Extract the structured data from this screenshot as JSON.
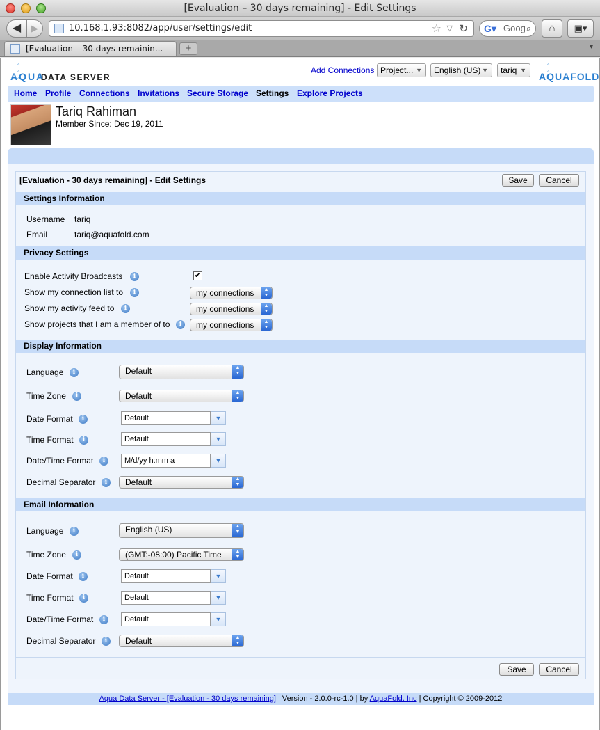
{
  "browser": {
    "window_title": "[Evaluation – 30 days remaining] - Edit Settings",
    "url": "10.168.1.93:8082/app/user/settings/edit",
    "search_placeholder": "Goog",
    "tab_title": "[Evaluation – 30 days remainin...",
    "new_tab_label": "+"
  },
  "header": {
    "logo_left_top": "° ° °",
    "logo_left_word": "AQUA",
    "logo_left_sub": "DATA SERVER",
    "add_connections": "Add Connections",
    "project_select": "Project...",
    "language_select": "English (US)",
    "user_select": "tariq",
    "logo_right_top": "° ° °",
    "logo_right_word": "AQUAFOLD"
  },
  "nav": {
    "home": "Home",
    "profile": "Profile",
    "connections": "Connections",
    "invitations": "Invitations",
    "secure_storage": "Secure Storage",
    "settings": "Settings",
    "explore_projects": "Explore Projects"
  },
  "profile": {
    "name": "Tariq Rahiman",
    "member_since": "Member Since: Dec 19, 2011"
  },
  "form": {
    "title": "[Evaluation - 30 days remaining] - Edit Settings",
    "save": "Save",
    "cancel": "Cancel"
  },
  "settings_info": {
    "header": "Settings Information",
    "username_label": "Username",
    "username_value": "tariq",
    "email_label": "Email",
    "email_value": "tariq@aquafold.com"
  },
  "privacy": {
    "header": "Privacy Settings",
    "broadcasts_label": "Enable Activity Broadcasts",
    "broadcasts_checked": "✔",
    "connection_list_label": "Show my connection list to",
    "connection_list_value": "my connections",
    "activity_feed_label": "Show my activity feed to",
    "activity_feed_value": "my connections",
    "projects_label": "Show projects that I am a member of to",
    "projects_value": "my connections"
  },
  "display": {
    "header": "Display Information",
    "language_label": "Language",
    "language_value": "Default",
    "timezone_label": "Time Zone",
    "timezone_value": "Default",
    "date_format_label": "Date Format",
    "date_format_value": "Default",
    "time_format_label": "Time Format",
    "time_format_value": "Default",
    "datetime_format_label": "Date/Time Format",
    "datetime_format_value": "M/d/yy h:mm a",
    "decimal_label": "Decimal Separator",
    "decimal_value": "Default"
  },
  "email": {
    "header": "Email Information",
    "language_label": "Language",
    "language_value": "English (US)",
    "timezone_label": "Time Zone",
    "timezone_value": "(GMT:-08:00) Pacific Time",
    "date_format_label": "Date Format",
    "date_format_value": "Default",
    "time_format_label": "Time Format",
    "time_format_value": "Default",
    "datetime_format_label": "Date/Time Format",
    "datetime_format_value": "Default",
    "decimal_label": "Decimal Separator",
    "decimal_value": "Default"
  },
  "footer": {
    "product_link": "Aqua Data Server - [Evaluation - 30 days remaining]",
    "version_text": " | Version - 2.0.0-rc-1.0 | by ",
    "company_link": "AquaFold, Inc",
    "copyright": " | Copyright © 2009-2012"
  },
  "icons": {
    "info": "info-icon",
    "dropdown": "dropdown-arrow-icon"
  }
}
